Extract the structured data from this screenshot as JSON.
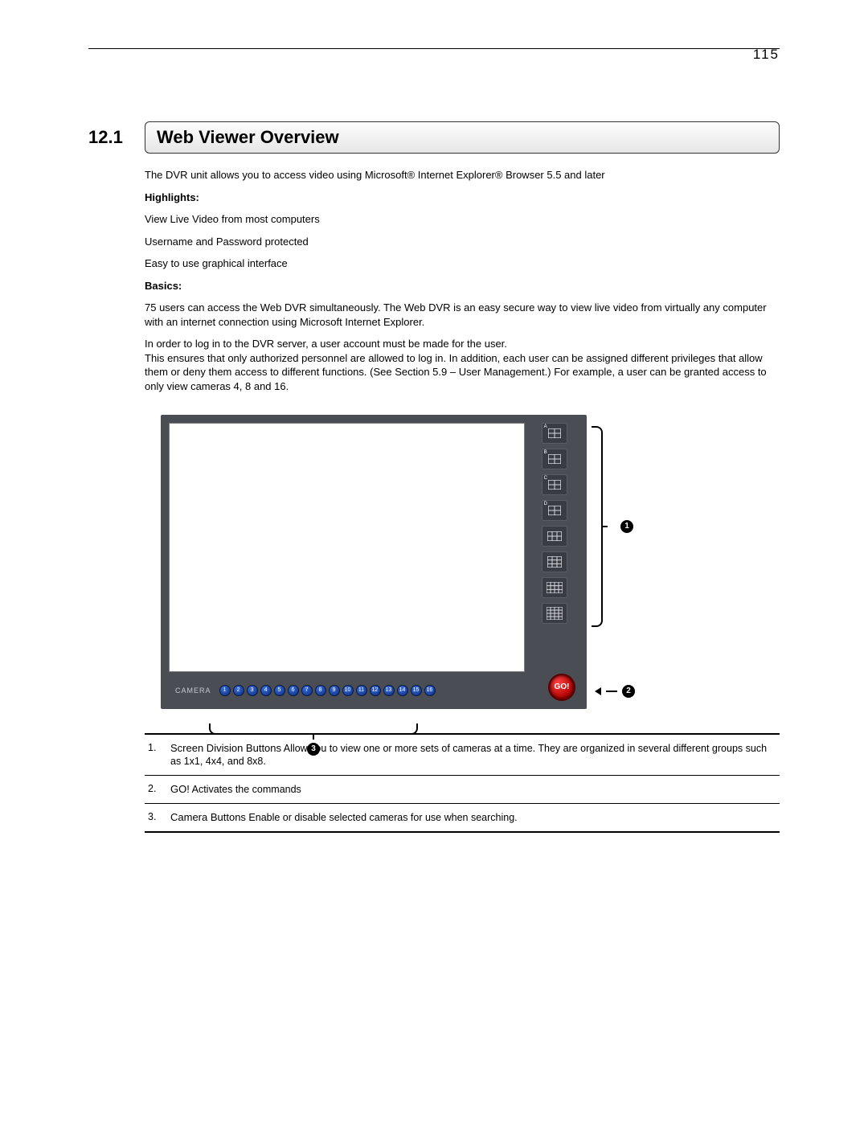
{
  "page_number": "115",
  "section_number": "12.1",
  "section_title": "Web Viewer Overview",
  "intro": "The DVR unit allows you to access video using Microsoft® Internet Explorer® Browser 5.5 and later",
  "highlights_label": "Highlights:",
  "highlights": [
    "View Live Video from most computers",
    "Username and Password protected",
    "Easy to use graphical interface"
  ],
  "basics_label": "Basics:",
  "basics_p1": "75 users can access the Web DVR simultaneously. The Web DVR is an easy secure way to view live video from virtually any computer with an internet connection using Microsoft Internet Explorer.",
  "basics_p2": "In order to log in to the DVR server, a user account must be made for the user.",
  "basics_p3": "This ensures that only authorized personnel are allowed to log in.  In addition, each user can be assigned different privileges that allow them or deny them access to different functions.  (See Section 5.9 – User Management.)  For example, a user can be granted access to only view cameras 4, 8 and 16.",
  "division_buttons": [
    "A",
    "B",
    "C",
    "D",
    "",
    "",
    "",
    ""
  ],
  "go_label": "GO!",
  "camera_label": "CAMERA",
  "camera_buttons": [
    "1",
    "2",
    "3",
    "4",
    "5",
    "6",
    "7",
    "8",
    "9",
    "10",
    "11",
    "12",
    "13",
    "14",
    "15",
    "16"
  ],
  "callouts": {
    "c1": "1",
    "c2": "2",
    "c3": "3"
  },
  "legend": [
    {
      "n": "1.",
      "lead": "Screen Division Buttons",
      "text": " Allow you to view one or more sets of cameras at a time.  They are organized in several different groups such as 1x1, 4x4, and 8x8."
    },
    {
      "n": "2.",
      "lead": "GO!",
      "text": " Activates the commands"
    },
    {
      "n": "3.",
      "lead": "Camera Buttons",
      "text": " Enable or disable selected cameras for use when searching."
    }
  ]
}
